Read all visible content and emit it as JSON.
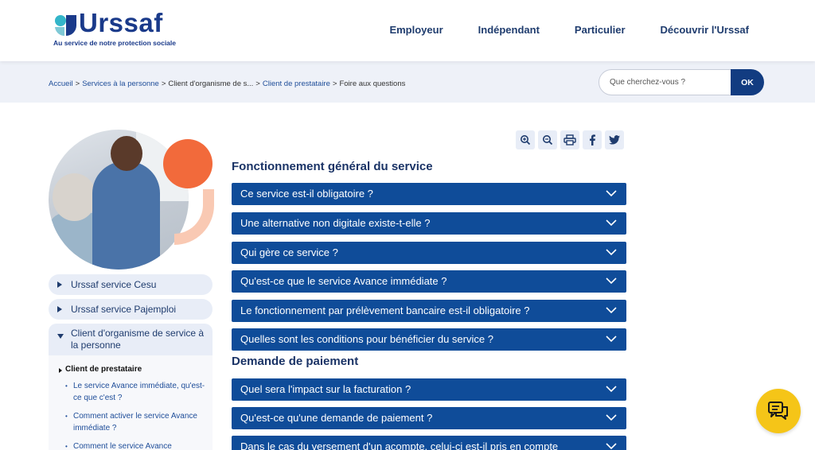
{
  "header": {
    "logo_word": "Urssaf",
    "logo_tagline": "Au service de notre protection sociale",
    "nav": [
      {
        "label": "Employeur"
      },
      {
        "label": "Indépendant"
      },
      {
        "label": "Particulier"
      },
      {
        "label": "Découvrir l'Urssaf"
      }
    ]
  },
  "breadcrumb": {
    "items": [
      {
        "label": "Accueil",
        "link": true
      },
      {
        "label": "Services à la personne",
        "link": true
      },
      {
        "label": "Client d'organisme de s...",
        "link": false
      },
      {
        "label": "Client de prestataire",
        "link": true
      },
      {
        "label": "Foire aux questions",
        "link": false
      }
    ],
    "separator": ">"
  },
  "search": {
    "placeholder": "Que cherchez-vous ?",
    "button_label": "OK"
  },
  "sidebar": {
    "items": [
      {
        "label": "Urssaf service Cesu"
      },
      {
        "label": "Urssaf service Pajemploi"
      },
      {
        "label": "Client d'organisme de service à la personne"
      }
    ],
    "sub_heading": "Client de prestataire",
    "sub_items": [
      {
        "label": "Le service Avance immédiate, qu'est-ce que c'est ?"
      },
      {
        "label": "Comment activer le service Avance immédiate ?"
      },
      {
        "label": "Comment le service Avance"
      }
    ]
  },
  "tools": {
    "icons": [
      "zoom-in-icon",
      "zoom-out-icon",
      "print-icon",
      "facebook-icon",
      "twitter-icon"
    ]
  },
  "main": {
    "section1_title": "Fonctionnement général du service",
    "section1_faqs": [
      "Ce service est-il obligatoire ?",
      "Une alternative non digitale existe-t-elle ?",
      "Qui gère ce service ?",
      "Qu'est-ce que le service Avance immédiate ?",
      "Le fonctionnement par prélèvement bancaire est-il obligatoire ?",
      "Quelles sont les conditions pour bénéficier du service ?"
    ],
    "section2_title": "Demande de paiement",
    "section2_faqs": [
      "Quel sera l'impact sur la facturation ?",
      "Qu'est-ce qu'une demande de paiement ?",
      "Dans le cas du versement d'un acompte, celui-ci est-il pris en compte"
    ]
  },
  "colors": {
    "brand_navy": "#1a3a8a",
    "faq_bar": "#0f4c99",
    "band_bg": "#eef1f8",
    "accent_orange": "#f26a3b",
    "chat_yellow": "#f5c518"
  }
}
